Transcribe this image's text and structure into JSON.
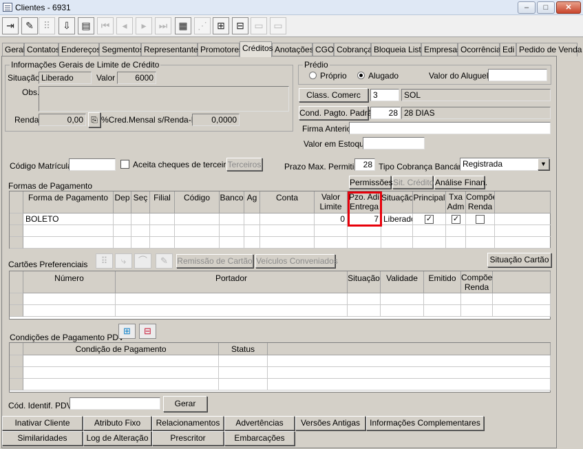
{
  "window": {
    "title": "Clientes - 6931",
    "minimize": "–",
    "maximize": "□",
    "close": "✕"
  },
  "toolbar": {
    "buttons": [
      {
        "name": "exit-icon",
        "glyph": "⇥",
        "disabled": false
      },
      {
        "name": "edit-icon",
        "glyph": "✎",
        "disabled": false
      },
      {
        "name": "tree-icon",
        "glyph": "⠿",
        "disabled": true
      },
      {
        "name": "download-icon",
        "glyph": "⇩",
        "disabled": false
      },
      {
        "name": "print-icon",
        "glyph": "▤",
        "disabled": false
      },
      {
        "name": "first-icon",
        "glyph": "⏮",
        "disabled": true
      },
      {
        "name": "prev-icon",
        "glyph": "◂",
        "disabled": true
      },
      {
        "name": "next-icon",
        "glyph": "▸",
        "disabled": true
      },
      {
        "name": "last-icon",
        "glyph": "⏭",
        "disabled": true
      },
      {
        "name": "grid-icon",
        "glyph": "▦",
        "disabled": false
      },
      {
        "name": "chart-icon",
        "glyph": "⋰",
        "disabled": true
      },
      {
        "name": "add-row-icon",
        "glyph": "⊞",
        "disabled": false
      },
      {
        "name": "remove-row-icon",
        "glyph": "⊟",
        "disabled": false
      },
      {
        "name": "table-icon",
        "glyph": "▭",
        "disabled": true
      },
      {
        "name": "table2-icon",
        "glyph": "▭",
        "disabled": true
      }
    ]
  },
  "tabs": [
    "Geral",
    "Contatos",
    "Endereços",
    "Segmentos",
    "Representantes",
    "Promotores",
    "Créditos",
    "Anotações",
    "CGO",
    "Cobrança",
    "Bloqueia Lista",
    "Empresas",
    "Ocorrência",
    "Edi",
    "Pedido de Venda"
  ],
  "active_tab": "Créditos",
  "limite": {
    "group_label": "Informações Gerais de Limite de Crédito",
    "situacao_label": "Situação",
    "situacao_value": "Liberado",
    "valor_label": "Valor",
    "valor_value": "6000",
    "obs_label": "Obs.",
    "renda_label": "Renda",
    "renda_value": "0,00",
    "cred_label": "%Cred.Mensal s/Renda-PF",
    "cred_value": "0,0000"
  },
  "predio": {
    "group_label": "Prédio",
    "proprio_label": "Próprio",
    "alugado_label": "Alugado",
    "aluguel_label": "Valor do Aluguel",
    "aluguel_value": ""
  },
  "comercial": {
    "class_button": "Class. Comerc",
    "class_code": "3",
    "class_desc": "SOL",
    "cond_button": "Cond. Pagto. Padrão",
    "cond_code": "28",
    "cond_desc": "28 DIAS",
    "firma_label": "Firma Anterior",
    "firma_value": "",
    "estoque_label": "Valor em Estoque",
    "estoque_value": ""
  },
  "matricula": {
    "label": "Código Matrícula",
    "value": "",
    "cheques_label": "Aceita cheques de terceiros",
    "terceiros_button": "Terceiros",
    "prazo_label": "Prazo Max. Permitido",
    "prazo_value": "28",
    "cobranca_label": "Tipo Cobrança Bancária",
    "cobranca_value": "Registrada"
  },
  "formas": {
    "label": "Formas de Pagamento",
    "buttons": [
      "Permissões",
      "Sit. Crédito",
      "Análise Finan."
    ],
    "columns": [
      "Forma de Pagamento",
      "Dep",
      "Seç",
      "Filial",
      "Código",
      "Banco",
      "Ag",
      "Conta",
      "Valor Limite",
      "Pzo. Adi Entrega",
      "Situação",
      "Principal",
      "Txa Adm",
      "Compõe Renda"
    ],
    "rows": [
      {
        "forma": "BOLETO",
        "dep": "",
        "sec": "",
        "filial": "",
        "codigo": "",
        "banco": "",
        "ag": "",
        "conta": "",
        "valor": "0",
        "pzo": "7",
        "situacao": "Liberado",
        "principal": true,
        "txa": true,
        "compoe": false
      }
    ]
  },
  "cartoes": {
    "label": "Cartões Preferenciais",
    "remissao_button": "Remissão de Cartão",
    "veiculos_button": "Veículos Conveniados",
    "situacao_button": "Situação Cartão",
    "columns": [
      "Número",
      "Portador",
      "Situação",
      "Validade",
      "Emitido",
      "Compõe Renda"
    ]
  },
  "condicoes": {
    "label": "Condições de Pagamento PDV",
    "columns": [
      "Condição de Pagamento",
      "Status"
    ]
  },
  "pdv": {
    "label": "Cód. Identif. PDV",
    "value": "",
    "gerar_button": "Gerar"
  },
  "bottom_buttons": [
    [
      "Inativar Cliente",
      "Atributo Fixo",
      "Relacionamentos",
      "Advertências",
      "Versões Antigas",
      "Informações Complementares"
    ],
    [
      "Similaridades",
      "Log de Alteração",
      "Prescritor",
      "Embarcações"
    ]
  ]
}
